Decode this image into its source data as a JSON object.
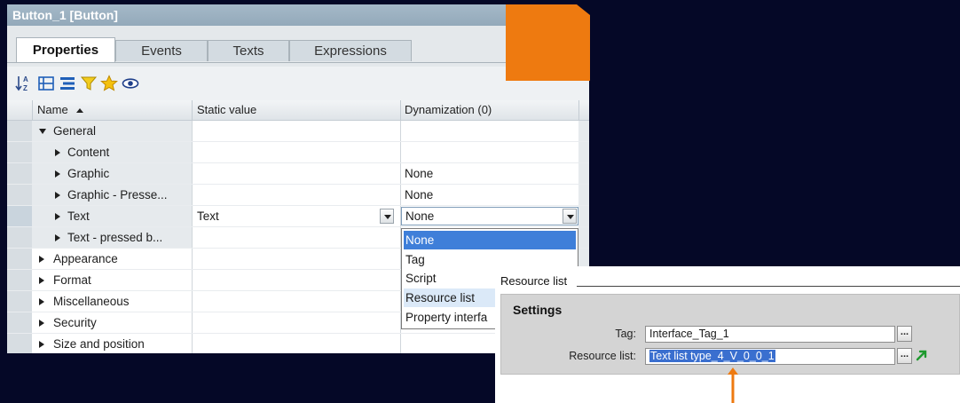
{
  "window": {
    "title": "Button_1 [Button]"
  },
  "tabs": [
    {
      "label": "Properties",
      "active": true
    },
    {
      "label": "Events",
      "active": false
    },
    {
      "label": "Texts",
      "active": false
    },
    {
      "label": "Expressions",
      "active": false
    }
  ],
  "toolbar": {
    "icons": [
      "sort-az-icon",
      "show-groups-icon",
      "list-view-icon",
      "filter-icon",
      "favorites-star-icon",
      "view-eye-icon"
    ]
  },
  "grid": {
    "columns": {
      "name": "Name",
      "static": "Static value",
      "dynamization": "Dynamization (0)"
    },
    "rows": [
      {
        "label": "General",
        "level": 0,
        "expanded": true,
        "static": "",
        "dyn": ""
      },
      {
        "label": "Content",
        "level": 1,
        "expanded": false,
        "static": "",
        "dyn": ""
      },
      {
        "label": "Graphic",
        "level": 1,
        "expanded": false,
        "static": "",
        "dyn": "None"
      },
      {
        "label": "Graphic - Presse...",
        "level": 1,
        "expanded": false,
        "static": "",
        "dyn": "None"
      },
      {
        "label": "Text",
        "level": 1,
        "expanded": false,
        "static": "Text",
        "dyn": "None"
      },
      {
        "label": "Text - pressed b...",
        "level": 1,
        "expanded": false,
        "static": "",
        "dyn": ""
      },
      {
        "label": "Appearance",
        "level": 0,
        "expanded": false,
        "static": "",
        "dyn": ""
      },
      {
        "label": "Format",
        "level": 0,
        "expanded": false,
        "static": "",
        "dyn": ""
      },
      {
        "label": "Miscellaneous",
        "level": 0,
        "expanded": false,
        "static": "",
        "dyn": ""
      },
      {
        "label": "Security",
        "level": 0,
        "expanded": false,
        "static": "",
        "dyn": ""
      },
      {
        "label": "Size and position",
        "level": 0,
        "expanded": false,
        "static": "",
        "dyn": ""
      }
    ]
  },
  "dropdown": {
    "selected": "None",
    "options": [
      "None",
      "Tag",
      "Script",
      "Resource list",
      "Property interfa"
    ]
  },
  "resource_panel": {
    "title": "Resource list",
    "section": "Settings",
    "tag_label": "Tag:",
    "tag_value": "Interface_Tag_1",
    "resource_label": "Resource list:",
    "resource_value": "Text list type_4_V_0_0_1"
  },
  "colors": {
    "accent_orange": "#ee7a10",
    "selection_blue": "#3f7fd9",
    "title_bar": "#9bb0c0",
    "background": "#050827"
  }
}
